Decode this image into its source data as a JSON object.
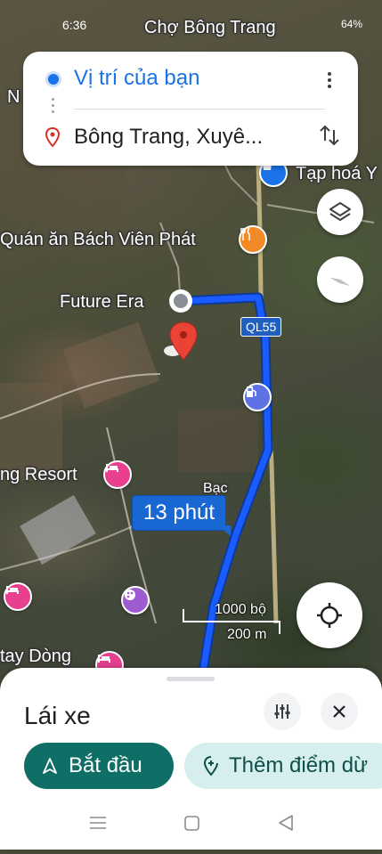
{
  "status": {
    "time": "6:36",
    "battery": "64%"
  },
  "directions": {
    "origin": "Vị trí của bạn",
    "destination": "Bông Trang, Xuyê..."
  },
  "map": {
    "labels": {
      "market": "Chợ Bông Trang",
      "grocery": "Tạp hoá Y",
      "restaurant": "Quán ăn Bách Viên Phát",
      "future_era": "Future Era",
      "resort": "ng Resort",
      "tay_dong": "tay Dòng",
      "n_letter": "N",
      "bac": "Bạc"
    },
    "highway": "QL55",
    "eta": "13 phút",
    "scale": {
      "feet": "1000 bộ",
      "meters": "200 m"
    },
    "route_color": "#1a5cff"
  },
  "sheet": {
    "title": "Lái xe",
    "start_label": "Bắt đầu",
    "add_stop_label": "Thêm điểm dừ"
  },
  "colors": {
    "accent": "#1a73e8",
    "start": "#0f6e66",
    "add_stop_bg": "#d6efee"
  }
}
